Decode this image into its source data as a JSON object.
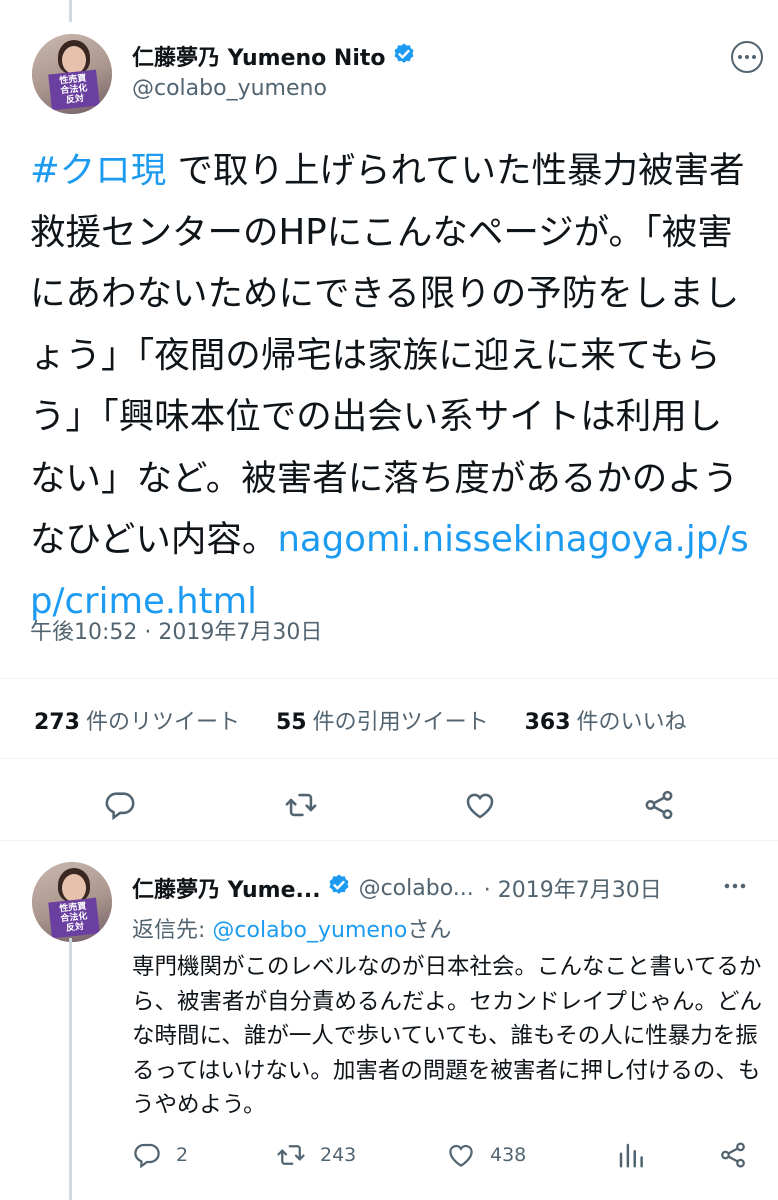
{
  "main_tweet": {
    "display_name": "仁藤夢乃 Yumeno Nito",
    "handle": "@colabo_yumeno",
    "hashtag": "#クロ現",
    "text": " で取り上げられていた性暴力被害者救援センターのHPにこんなページが。「被害にあわないためにできる限りの予防をしましょう」「夜間の帰宅は家族に迎えに来てもらう」「興味本位での出会い系サイトは利用しない」など。被害者に落ち度があるかのようなひどい内容。",
    "link": "nagomi.nissekinagoya.jp/sp/crime.html",
    "timestamp": "午後10:52 · 2019年7月30日",
    "avatar_sign": "性売買\n合法化\n反対"
  },
  "stats": [
    {
      "count": "273",
      "label": "件のリツイート"
    },
    {
      "count": "55",
      "label": "件の引用ツイート"
    },
    {
      "count": "363",
      "label": "件のいいね"
    }
  ],
  "reply_tweet": {
    "display_name": "仁藤夢乃 Yume...",
    "handle": "@colabo...",
    "date": "· 2019年7月30日",
    "replying_prefix": "返信先: ",
    "replying_handle": "@colabo_yumeno",
    "replying_suffix": "さん",
    "text": "専門機関がこのレベルなのが日本社会。こんなこと書いてるから、被害者が自分責めるんだよ。セカンドレイプじゃん。どんな時間に、誰が一人で歩いていても、誰もその人に性暴力を振るってはいけない。加害者の問題を被害者に押し付けるの、もうやめよう。",
    "reply_count": "2",
    "retweet_count": "243",
    "like_count": "438"
  },
  "colors": {
    "accent": "#1d9bf0",
    "secondary_text": "#536471",
    "text": "#0f1419"
  }
}
